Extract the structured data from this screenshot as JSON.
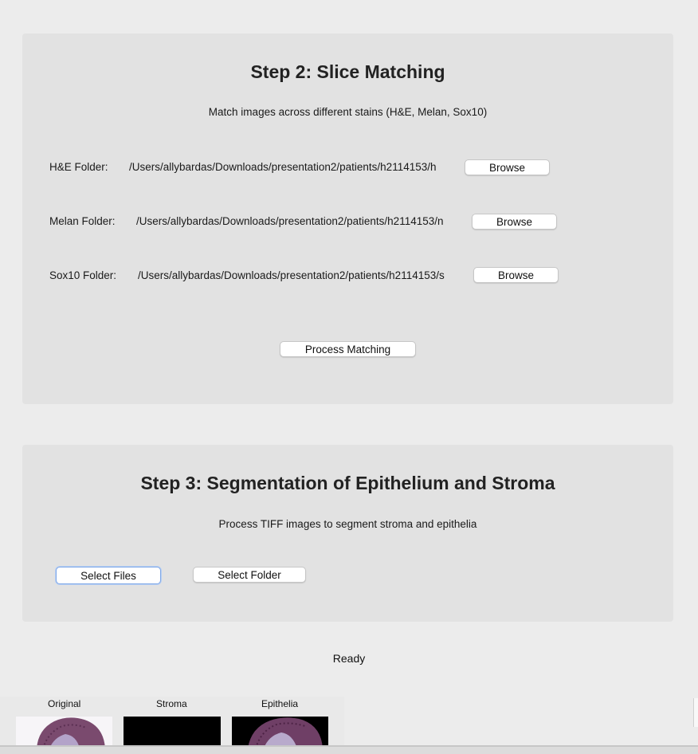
{
  "step2": {
    "title": "Step 2: Slice Matching",
    "subtitle": "Match images across different stains (H&E, Melan, Sox10)",
    "he_label": "H&E Folder:",
    "he_path": "/Users/allybardas/Downloads/presentation2/patients/h2114153/h",
    "melan_label": "Melan Folder:",
    "melan_path": "/Users/allybardas/Downloads/presentation2/patients/h2114153/n",
    "sox10_label": "Sox10 Folder:",
    "sox10_path": "/Users/allybardas/Downloads/presentation2/patients/h2114153/s",
    "browse_label": "Browse",
    "process_label": "Process Matching"
  },
  "step3": {
    "title": "Step 3: Segmentation of Epithelium and Stroma",
    "subtitle": "Process TIFF images to segment stroma and epithelia",
    "select_files_label": "Select Files",
    "select_folder_label": "Select Folder"
  },
  "status": "Ready",
  "thumbnails": {
    "original": "Original",
    "stroma": "Stroma",
    "epithelia": "Epithelia"
  },
  "colors": {
    "panel_bg": "#e2e2e2",
    "window_bg": "#ececec",
    "focus_ring": "#7fa7e6",
    "tissue": "#7a4a6e",
    "stroma_bg": "#000000"
  }
}
